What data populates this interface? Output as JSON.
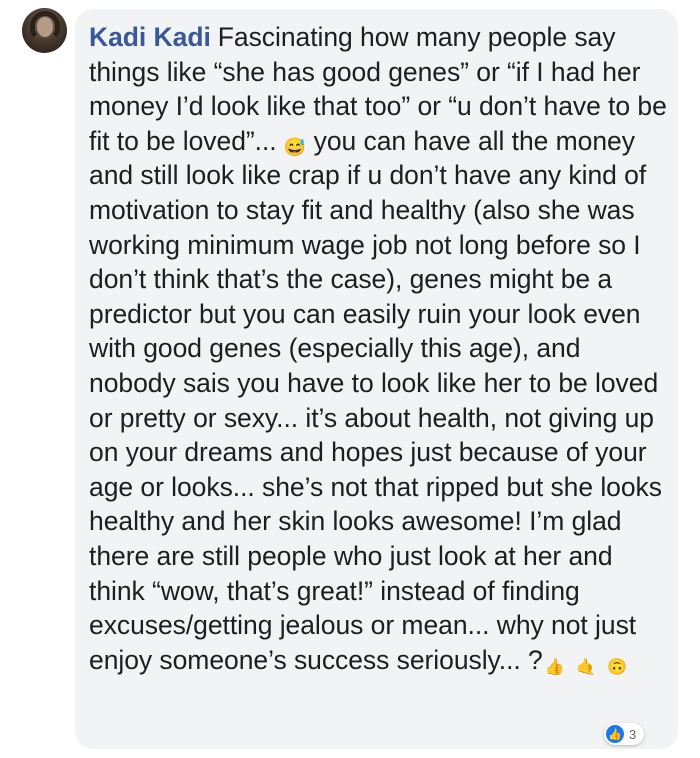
{
  "comment": {
    "author": "Kadi Kadi",
    "text_parts": [
      "Fascinating how many people say things like “she has good genes” or “if I had her money I’d look like that too” or “u don’t have to be fit to be loved”...",
      "you can have all the money and still look like crap if u don’t have any kind of motivation to stay fit and healthy (also she was working minimum wage job not long before so I don’t think that’s the case), genes might be a predictor but you can easily ruin your look even with good genes (especially this age), and nobody sais you have to look like her to be loved or pretty or sexy... it’s about health, not giving up on your dreams and hopes just because of your age or looks... she’s not that ripped but she looks healthy and her skin looks awesome! I’m glad there are still people who just look at her and think “wow, that’s great!” instead of finding excuses/getting jealous or mean... why not just enjoy someone’s success seriously... ?"
    ],
    "emojis": {
      "sweat_smile": "😅",
      "thumbs_up": "👍",
      "call_me": "🤙",
      "upside_down": "🙃"
    },
    "reactions": {
      "icon": "like-icon",
      "count": "3"
    }
  },
  "colors": {
    "author": "#385898",
    "bubble": "#f2f3f5",
    "like": "#1877f2"
  }
}
